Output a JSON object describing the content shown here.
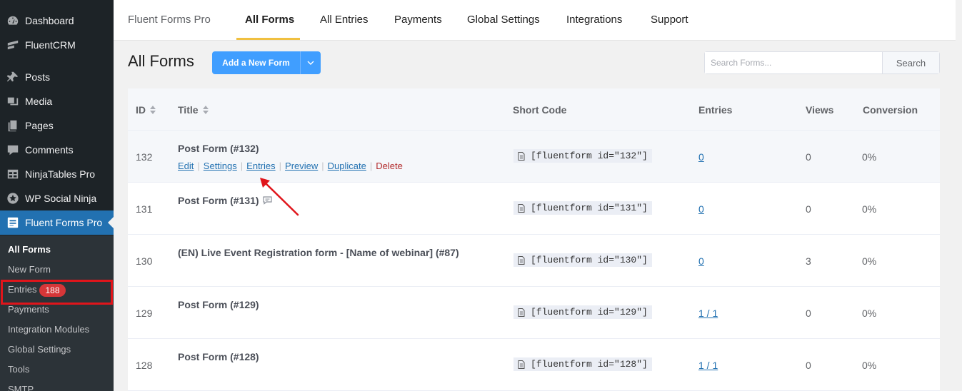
{
  "sidebar": {
    "items": [
      {
        "label": "Dashboard",
        "icon": "dashboard-icon"
      },
      {
        "label": "FluentCRM",
        "icon": "fluentcrm-icon"
      },
      {
        "label": "Posts",
        "icon": "pin-icon"
      },
      {
        "label": "Media",
        "icon": "media-icon"
      },
      {
        "label": "Pages",
        "icon": "pages-icon"
      },
      {
        "label": "Comments",
        "icon": "comment-icon"
      },
      {
        "label": "NinjaTables Pro",
        "icon": "table-icon"
      },
      {
        "label": "WP Social Ninja",
        "icon": "star-icon"
      },
      {
        "label": "Fluent Forms Pro",
        "icon": "fluentforms-icon"
      }
    ],
    "submenu": [
      {
        "label": "All Forms"
      },
      {
        "label": "New Form"
      },
      {
        "label": "Entries",
        "badge": "188"
      },
      {
        "label": "Payments"
      },
      {
        "label": "Integration Modules"
      },
      {
        "label": "Global Settings"
      },
      {
        "label": "Tools"
      },
      {
        "label": "SMTP"
      }
    ]
  },
  "topnav": {
    "brand": "Fluent Forms Pro",
    "tabs": [
      "All Forms",
      "All Entries",
      "Payments",
      "Global Settings",
      "Integrations",
      "Support"
    ]
  },
  "header": {
    "title": "All Forms",
    "add_button": "Add a New Form",
    "search_placeholder": "Search Forms...",
    "search_button": "Search"
  },
  "table": {
    "columns": [
      "ID",
      "Title",
      "Short Code",
      "Entries",
      "Views",
      "Conversion"
    ],
    "row_actions": [
      "Edit",
      "Settings",
      "Entries",
      "Preview",
      "Duplicate",
      "Delete"
    ],
    "rows": [
      {
        "id": "132",
        "title": "Post Form (#132)",
        "shortcode": "[fluentform id=\"132\"]",
        "entries": "0",
        "views": "0",
        "conversion": "0%"
      },
      {
        "id": "131",
        "title": "Post Form (#131)",
        "shortcode": "[fluentform id=\"131\"]",
        "entries": "0",
        "views": "0",
        "conversion": "0%"
      },
      {
        "id": "130",
        "title": "(EN) Live Event Registration form - [Name of webinar] (#87)",
        "shortcode": "[fluentform id=\"130\"]",
        "entries": "0",
        "views": "3",
        "conversion": "0%"
      },
      {
        "id": "129",
        "title": "Post Form (#129)",
        "shortcode": "[fluentform id=\"129\"]",
        "entries": "1 / 1",
        "views": "0",
        "conversion": "0%"
      },
      {
        "id": "128",
        "title": "Post Form (#128)",
        "shortcode": "[fluentform id=\"128\"]",
        "entries": "1 / 1",
        "views": "0",
        "conversion": "0%"
      }
    ]
  },
  "colors": {
    "sidebar_bg": "#1d2327",
    "active_menu": "#2271b1",
    "primary_button": "#409eff",
    "badge": "#d63638",
    "annotation_red": "#e0151b",
    "tab_underline": "#f0c040",
    "link": "#2271b1",
    "delete": "#b32d2e"
  }
}
